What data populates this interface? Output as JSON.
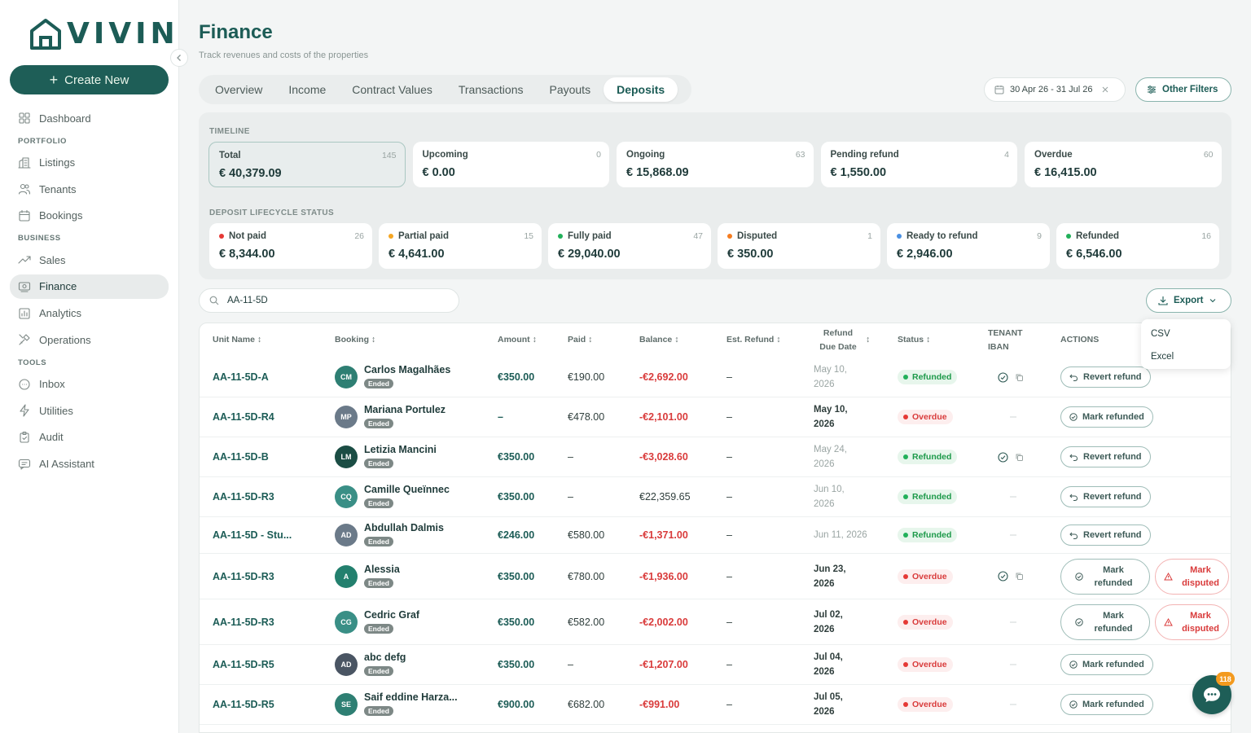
{
  "brand": {
    "name": "VIVIN",
    "create_label": "Create New"
  },
  "sidebar": {
    "items": [
      {
        "label": "Dashboard",
        "icon": "grid-icon"
      },
      {
        "section": "PORTFOLIO"
      },
      {
        "label": "Listings",
        "icon": "building-icon"
      },
      {
        "label": "Tenants",
        "icon": "users-icon"
      },
      {
        "label": "Bookings",
        "icon": "calendar-icon"
      },
      {
        "section": "BUSINESS"
      },
      {
        "label": "Sales",
        "icon": "trend-icon"
      },
      {
        "label": "Finance",
        "icon": "finance-icon",
        "active": true
      },
      {
        "label": "Analytics",
        "icon": "chart-icon"
      },
      {
        "label": "Operations",
        "icon": "tools-icon"
      },
      {
        "section": "TOOLS"
      },
      {
        "label": "Inbox",
        "icon": "chat-icon"
      },
      {
        "label": "Utilities",
        "icon": "bolt-icon"
      },
      {
        "label": "Audit",
        "icon": "clipboard-icon"
      },
      {
        "label": "AI Assistant",
        "icon": "assistant-icon"
      }
    ]
  },
  "page": {
    "title": "Finance",
    "subtitle": "Track revenues and costs of the properties"
  },
  "tabs": [
    {
      "label": "Overview"
    },
    {
      "label": "Income"
    },
    {
      "label": "Contract Values"
    },
    {
      "label": "Transactions"
    },
    {
      "label": "Payouts"
    },
    {
      "label": "Deposits",
      "active": true
    }
  ],
  "filters": {
    "date_range": "30 Apr 26 - 31 Jul 26",
    "other_label": "Other Filters"
  },
  "timeline": {
    "label": "TIMELINE",
    "cards": [
      {
        "label": "Total",
        "count": "145",
        "value": "€ 40,379.09",
        "selected": true
      },
      {
        "label": "Upcoming",
        "count": "0",
        "value": "€ 0.00"
      },
      {
        "label": "Ongoing",
        "count": "63",
        "value": "€ 15,868.09"
      },
      {
        "label": "Pending refund",
        "count": "4",
        "value": "€ 1,550.00"
      },
      {
        "label": "Overdue",
        "count": "60",
        "value": "€ 16,415.00"
      }
    ]
  },
  "lifecycle": {
    "label": "DEPOSIT LIFECYCLE STATUS",
    "cards": [
      {
        "label": "Not paid",
        "count": "26",
        "value": "€ 8,344.00",
        "color": "#e53935"
      },
      {
        "label": "Partial paid",
        "count": "15",
        "value": "€ 4,641.00",
        "color": "#f5a623"
      },
      {
        "label": "Fully paid",
        "count": "47",
        "value": "€ 29,040.00",
        "color": "#22b05a"
      },
      {
        "label": "Disputed",
        "count": "1",
        "value": "€ 350.00",
        "color": "#f57c1f"
      },
      {
        "label": "Ready to refund",
        "count": "9",
        "value": "€ 2,946.00",
        "color": "#4a90e2"
      },
      {
        "label": "Refunded",
        "count": "16",
        "value": "€ 6,546.00",
        "color": "#22b05a"
      }
    ]
  },
  "search": {
    "value": "AA-11-5D"
  },
  "export": {
    "label": "Export",
    "options": [
      "CSV",
      "Excel"
    ]
  },
  "table": {
    "headers": {
      "unit": "Unit Name",
      "booking": "Booking",
      "amount": "Amount",
      "paid": "Paid",
      "balance": "Balance",
      "est_refund": "Est. Refund",
      "refund_due_1": "Refund",
      "refund_due_2": "Due Date",
      "status": "Status",
      "iban_1": "TENANT",
      "iban_2": "IBAN",
      "actions": "ACTIONS"
    },
    "rows": [
      {
        "unit": "AA-11-5D-A",
        "initials": "CM",
        "avatar_color": "#2e7f73",
        "name": "Carlos Magalhães",
        "booking_status": "Ended",
        "amount": "€350.00",
        "paid": "€190.00",
        "balance": "-€2,692.00",
        "balance_neg": true,
        "est_refund": "–",
        "due1": "May 10,",
        "due2": "2026",
        "due_bold": false,
        "status": "Refunded",
        "iban": true,
        "actions": [
          "Revert refund"
        ]
      },
      {
        "unit": "AA-11-5D-R4",
        "initials": "MP",
        "avatar_color": "#6b7a89",
        "name": "Mariana Portulez",
        "booking_status": "Ended",
        "amount": "–",
        "paid": "€478.00",
        "balance": "-€2,101.00",
        "balance_neg": true,
        "est_refund": "–",
        "due1": "May 10,",
        "due2": "2026",
        "due_bold": true,
        "status": "Overdue",
        "iban": false,
        "actions": [
          "Mark refunded"
        ]
      },
      {
        "unit": "AA-11-5D-B",
        "initials": "LM",
        "avatar_color": "#1b4d44",
        "name": "Letizia Mancini",
        "booking_status": "Ended",
        "amount": "€350.00",
        "paid": "–",
        "balance": "-€3,028.60",
        "balance_neg": true,
        "est_refund": "–",
        "due1": "May 24,",
        "due2": "2026",
        "due_bold": false,
        "status": "Refunded",
        "iban": true,
        "actions": [
          "Revert refund"
        ]
      },
      {
        "unit": "AA-11-5D-R3",
        "initials": "CQ",
        "avatar_color": "#3a8f86",
        "name": "Camille Queïnnec",
        "booking_status": "Ended",
        "amount": "€350.00",
        "paid": "–",
        "balance": "€22,359.65",
        "balance_neg": false,
        "est_refund": "–",
        "due1": "Jun 10,",
        "due2": "2026",
        "due_bold": false,
        "status": "Refunded",
        "iban": false,
        "actions": [
          "Revert refund"
        ]
      },
      {
        "unit": "AA-11-5D - Stu...",
        "initials": "AD",
        "avatar_color": "#6b7a89",
        "name": "Abdullah Dalmis",
        "booking_status": "Ended",
        "amount": "€246.00",
        "paid": "€580.00",
        "balance": "-€1,371.00",
        "balance_neg": true,
        "est_refund": "–",
        "due1": "Jun 11, 2026",
        "due2": "",
        "due_bold": false,
        "status": "Refunded",
        "iban": false,
        "actions": [
          "Revert refund"
        ]
      },
      {
        "unit": "AA-11-5D-R3",
        "initials": "A",
        "avatar_color": "#23806e",
        "name": "Alessia",
        "booking_status": "Ended",
        "amount": "€350.00",
        "paid": "€780.00",
        "balance": "-€1,936.00",
        "balance_neg": true,
        "est_refund": "–",
        "due1": "Jun 23,",
        "due2": "2026",
        "due_bold": true,
        "status": "Overdue",
        "iban": true,
        "actions": [
          "Mark refunded",
          "Mark disputed"
        ]
      },
      {
        "unit": "AA-11-5D-R3",
        "initials": "CG",
        "avatar_color": "#3a8f86",
        "name": "Cedric Graf",
        "booking_status": "Ended",
        "amount": "€350.00",
        "paid": "€582.00",
        "balance": "-€2,002.00",
        "balance_neg": true,
        "est_refund": "–",
        "due1": "Jul 02,",
        "due2": "2026",
        "due_bold": true,
        "status": "Overdue",
        "iban": false,
        "actions": [
          "Mark refunded",
          "Mark disputed"
        ]
      },
      {
        "unit": "AA-11-5D-R5",
        "initials": "AD",
        "avatar_color": "#4a5563",
        "name": "abc defg",
        "booking_status": "Ended",
        "amount": "€350.00",
        "paid": "–",
        "balance": "-€1,207.00",
        "balance_neg": true,
        "est_refund": "–",
        "due1": "Jul 04,",
        "due2": "2026",
        "due_bold": true,
        "status": "Overdue",
        "iban": false,
        "actions": [
          "Mark refunded"
        ]
      },
      {
        "unit": "AA-11-5D-R5",
        "initials": "SE",
        "avatar_color": "#2e7f73",
        "name": "Saif eddine Harza...",
        "booking_status": "Ended",
        "amount": "€900.00",
        "paid": "€682.00",
        "balance": "-€991.00",
        "balance_neg": true,
        "est_refund": "–",
        "due1": "Jul 05,",
        "due2": "2026",
        "due_bold": true,
        "status": "Overdue",
        "iban": false,
        "actions": [
          "Mark refunded"
        ]
      }
    ]
  },
  "chat": {
    "count": "118"
  }
}
